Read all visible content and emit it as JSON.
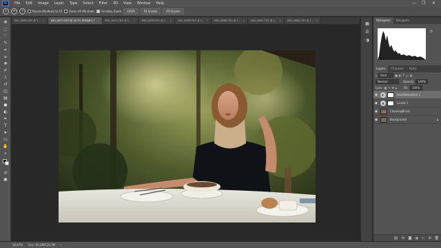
{
  "menu": {
    "logo": "Ps",
    "items": [
      "File",
      "Edit",
      "Image",
      "Layer",
      "Type",
      "Select",
      "Filter",
      "3D",
      "View",
      "Window",
      "Help"
    ],
    "window_controls": [
      "—",
      "❐",
      "✕"
    ]
  },
  "options": {
    "resize_windows_label": "Resize Windows to Fit",
    "zoom_all_windows_label": "Zoom All Windows",
    "scrubby_zoom_label": "Scrubby Zoom",
    "zoom_value": "100%",
    "fit_screen_label": "Fit Screen",
    "fill_screen_label": "Fill Screen"
  },
  "tabs": [
    {
      "label": "IMG_0865.CR2 @ 1...",
      "active": false
    },
    {
      "label": "IMG_0872.CR2 @ 16.7% (RGB/8*) *",
      "active": true
    },
    {
      "label": "IMG_0875.CR2 @ 1...",
      "active": false
    },
    {
      "label": "IMG_0876.CR2 @ 1...",
      "active": false
    },
    {
      "label": "IMG_0878.CR2 @ 1...",
      "active": false
    },
    {
      "label": "IMG_0880.CR2 @ 1...",
      "active": false
    },
    {
      "label": "IMG_0881.CR2 @ 1...",
      "active": false
    },
    {
      "label": "IMG_0882.CR2 @ 1...",
      "active": false
    }
  ],
  "status": {
    "zoom": "16.67%",
    "doc": "Doc: 60,2M/120,3M"
  },
  "histogram": {
    "tabs": [
      "Histogram",
      "Navigator"
    ]
  },
  "layers_panel": {
    "tabs": [
      "Layers",
      "Channels",
      "Paths"
    ],
    "kind_label": "Kind",
    "blend_mode": "Normal",
    "opacity_label": "Opacity:",
    "opacity_value": "100%",
    "lock_label": "Lock:",
    "fill_label": "Fill:",
    "fill_value": "100%",
    "layers": [
      {
        "name": "Hue/Saturation 1",
        "type": "adjustment",
        "selected": true
      },
      {
        "name": "Levels 1",
        "type": "adjustment",
        "selected": false
      },
      {
        "name": "CleaningBrush",
        "type": "pixel",
        "selected": false
      },
      {
        "name": "Background",
        "type": "background",
        "selected": false
      }
    ]
  },
  "colors": {
    "ui_dark": "#282828",
    "ui_mid": "#535353",
    "accent": "#31a8ff"
  }
}
